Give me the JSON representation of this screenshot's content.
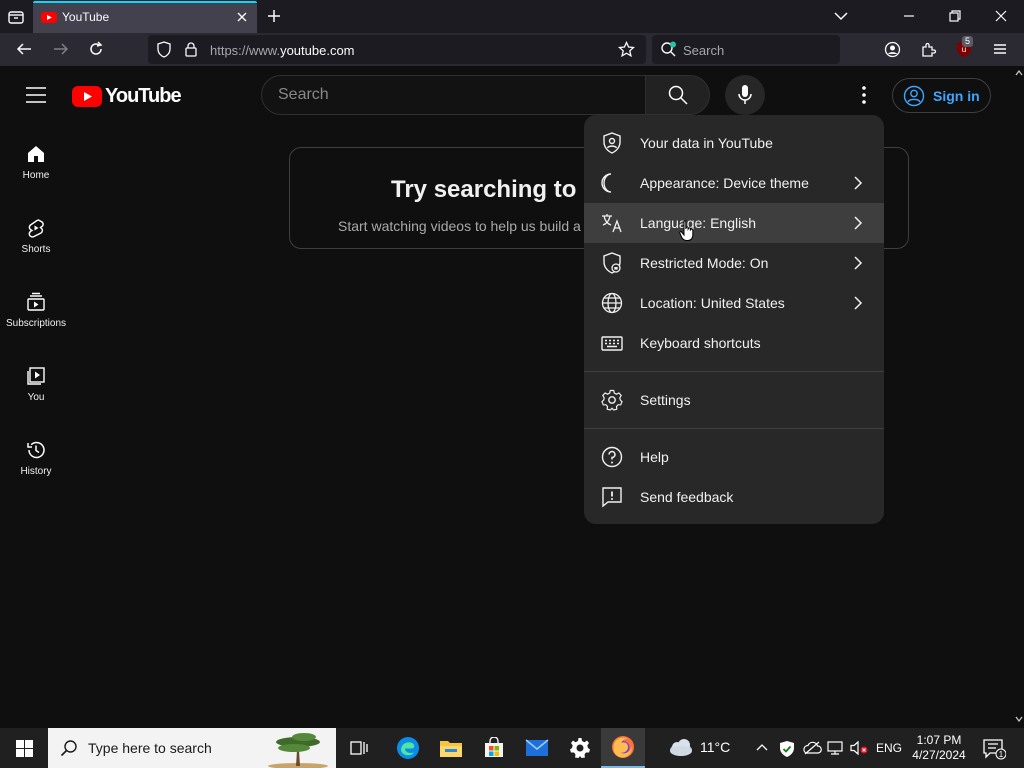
{
  "browser": {
    "tab": {
      "title": "YouTube"
    },
    "url": {
      "prefix": "https://www.",
      "domain": "youtube.com"
    },
    "search_placeholder": "Search",
    "extension_badge": "5"
  },
  "youtube": {
    "logo_text": "YouTube",
    "search_placeholder": "Search",
    "signin_label": "Sign in",
    "guide": [
      {
        "label": "Home"
      },
      {
        "label": "Shorts"
      },
      {
        "label": "Subscriptions"
      },
      {
        "label": "You"
      },
      {
        "label": "History"
      }
    ],
    "promo": {
      "title": "Try searching to get started",
      "subtitle": "Start watching videos to help us build a feed of videos you'll love."
    },
    "menu": {
      "items": [
        {
          "label": "Your data in YouTube",
          "icon": "shield-person-icon",
          "submenu": false
        },
        {
          "label": "Appearance: Device theme",
          "icon": "moon-icon",
          "submenu": true
        },
        {
          "label": "Language: English",
          "icon": "translate-icon",
          "submenu": true
        },
        {
          "label": "Restricted Mode: On",
          "icon": "restricted-icon",
          "submenu": true
        },
        {
          "label": "Location: United States",
          "icon": "globe-icon",
          "submenu": true
        },
        {
          "label": "Keyboard shortcuts",
          "icon": "keyboard-icon",
          "submenu": false
        },
        {
          "label": "Settings",
          "icon": "gear-icon",
          "submenu": false
        },
        {
          "label": "Help",
          "icon": "help-icon",
          "submenu": false
        },
        {
          "label": "Send feedback",
          "icon": "feedback-icon",
          "submenu": false
        }
      ]
    }
  },
  "taskbar": {
    "search_placeholder": "Type here to search",
    "weather": "11°C",
    "language": "ENG",
    "time": "1:07 PM",
    "date": "4/27/2024",
    "notification_count": "1"
  },
  "colors": {
    "yt_red": "#ff0000",
    "link_blue": "#3ea6ff",
    "tab_accent": "#00ddff"
  }
}
